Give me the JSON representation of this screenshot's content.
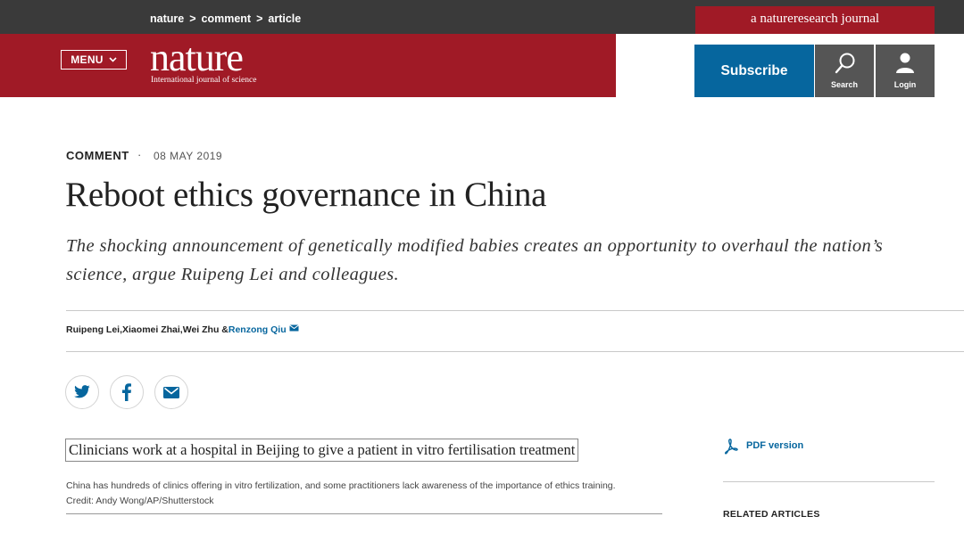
{
  "breadcrumb": [
    "nature",
    "comment",
    "article"
  ],
  "breadcrumb_separator": ">",
  "header": {
    "journal_tag": "a natureresearch journal",
    "menu_label": "MENU",
    "logo_word": "nature",
    "logo_subtitle": "International journal of science",
    "subscribe_label": "Subscribe",
    "search_label": "Search",
    "login_label": "Login"
  },
  "article": {
    "type": "COMMENT",
    "separator": "·",
    "date": "08 MAY 2019",
    "title": "Reboot ethics governance in China",
    "standfirst": "The shocking announcement of genetically modified babies creates an opportunity to overhaul the nation’s science, argue Ruipeng Lei and colleagues.",
    "authors": [
      "Ruipeng Lei",
      "Xiaomei Zhai",
      "Wei Zhu",
      "Renzong Qiu"
    ],
    "author_sep1": ",",
    "author_sep2": ",",
    "author_sep3": " &",
    "figure_title": "Clinicians work at a hospital in Beijing to give a patient in vitro fertilisation treatment",
    "figure_caption": "China has hundreds of clinics offering in vitro fertilization, and some practitioners lack awareness of the importance of ethics training.   Credit: Andy Wong/AP/Shutterstock"
  },
  "sidebar": {
    "pdf_label": "PDF version",
    "related_heading": "RELATED ARTICLES"
  },
  "share_icons": [
    "twitter-icon",
    "facebook-icon",
    "email-icon"
  ],
  "colors": {
    "brand_red": "#a01a26",
    "topbar": "#3a3a3a",
    "link_blue": "#06669e",
    "tool_gray": "#555555"
  }
}
